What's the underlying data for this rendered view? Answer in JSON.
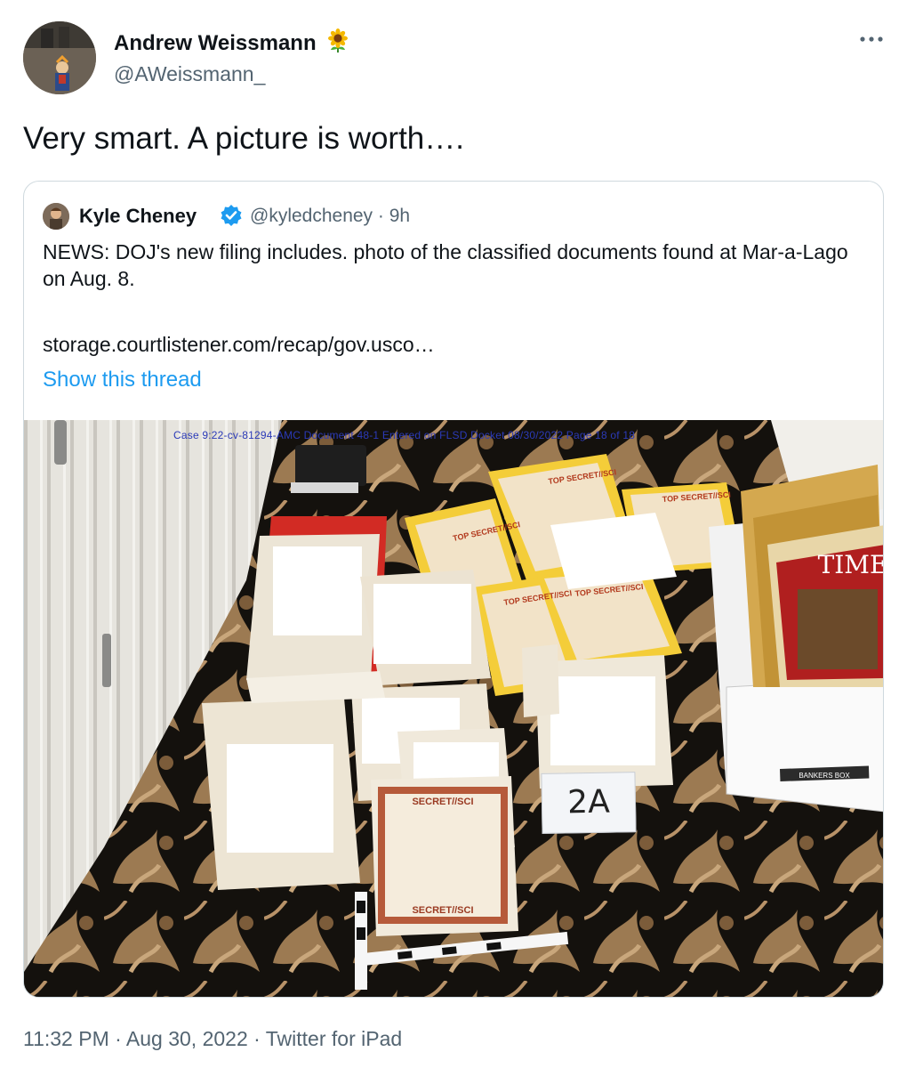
{
  "tweet": {
    "author_name": "Andrew Weissmann",
    "author_handle": "@AWeissmann_",
    "text": "Very smart. A picture is worth….",
    "timestamp": "11:32 PM · Aug 30, 2022 · Twitter for iPad",
    "more_icon": "more-horizontal-icon"
  },
  "quote": {
    "author_name": "Kyle Cheney",
    "author_handle": "@kyledcheney · 9h",
    "text": "NEWS: DOJ's new filing includes. photo of the classified documents found at Mar-a-Lago on Aug. 8.",
    "link": "storage.courtlistener.com/recap/gov.usco…",
    "show_thread": "Show this thread",
    "photo": {
      "case_header": "Case 9:22-cv-81294-AMC   Document 48-1   Entered on FLSD Docket 08/30/2022   Page 18 of 18",
      "marker_label": "2A",
      "doc_top_secret": "TOP SECRET//SCI",
      "doc_secret": "SECRET//SCI",
      "box_label": "BANKERS BOX",
      "magazine_title": "TIME"
    }
  },
  "colors": {
    "link_blue": "#1d9bf0",
    "secondary": "#536471",
    "border": "#cfd9de"
  }
}
